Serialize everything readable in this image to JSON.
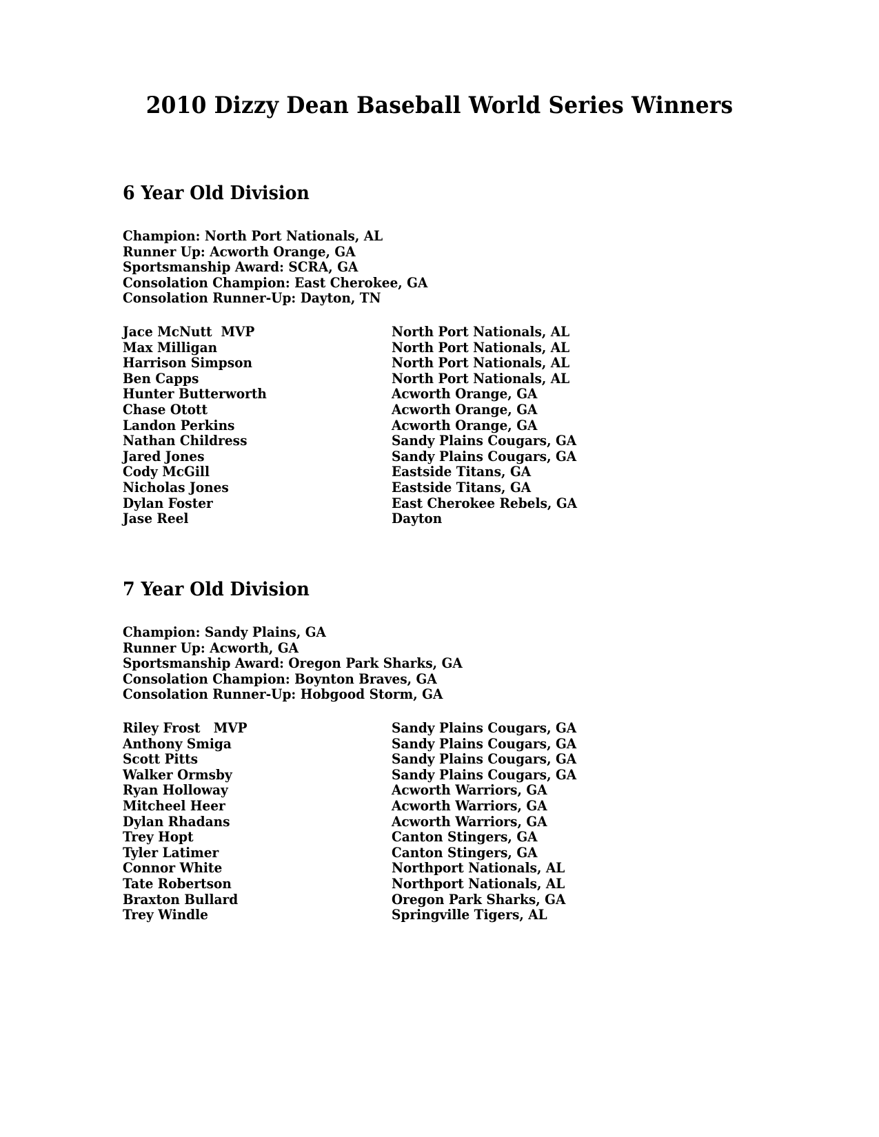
{
  "document": {
    "title": "2010 Dizzy Dean Baseball World Series Winners"
  },
  "sections": [
    {
      "heading": "6 Year Old Division",
      "awards": [
        "Champion: North Port Nationals, AL",
        "Runner Up: Acworth Orange, GA",
        "Sportsmanship Award: SCRA, GA",
        "Consolation Champion: East Cherokee, GA",
        "Consolation Runner-Up: Dayton, TN"
      ],
      "players": [
        {
          "name": "Jace McNutt  MVP",
          "team": "North Port Nationals, AL"
        },
        {
          "name": "Max Milligan",
          "team": "North Port Nationals, AL"
        },
        {
          "name": "Harrison Simpson",
          "team": "North Port Nationals, AL"
        },
        {
          "name": "Ben Capps",
          "team": "North Port Nationals, AL"
        },
        {
          "name": "Hunter Butterworth",
          "team": "Acworth Orange, GA"
        },
        {
          "name": "Chase Otott",
          "team": "Acworth Orange, GA"
        },
        {
          "name": "Landon Perkins",
          "team": "Acworth Orange, GA"
        },
        {
          "name": "Nathan Childress",
          "team": "Sandy Plains Cougars, GA"
        },
        {
          "name": "Jared Jones",
          "team": "Sandy Plains Cougars, GA"
        },
        {
          "name": "Cody McGill",
          "team": "Eastside Titans, GA"
        },
        {
          "name": "Nicholas Jones",
          "team": "Eastside Titans, GA"
        },
        {
          "name": "Dylan Foster",
          "team": "East Cherokee Rebels, GA"
        },
        {
          "name": "Jase Reel",
          "team": "Dayton"
        }
      ]
    },
    {
      "heading": "7 Year Old Division",
      "awards": [
        "Champion: Sandy Plains, GA",
        "Runner Up: Acworth, GA",
        "Sportsmanship Award: Oregon Park Sharks, GA",
        "Consolation Champion: Boynton Braves, GA",
        "Consolation Runner-Up: Hobgood Storm, GA"
      ],
      "players": [
        {
          "name": "Riley Frost   MVP",
          "team": "Sandy Plains Cougars, GA"
        },
        {
          "name": "Anthony Smiga",
          "team": "Sandy Plains Cougars, GA"
        },
        {
          "name": "Scott Pitts",
          "team": "Sandy Plains Cougars, GA"
        },
        {
          "name": "Walker Ormsby",
          "team": "Sandy Plains Cougars, GA"
        },
        {
          "name": "Ryan Holloway",
          "team": "Acworth Warriors, GA"
        },
        {
          "name": "Mitcheel Heer",
          "team": "Acworth Warriors, GA"
        },
        {
          "name": "Dylan Rhadans",
          "team": "Acworth Warriors, GA"
        },
        {
          "name": "Trey Hopt",
          "team": "Canton Stingers, GA"
        },
        {
          "name": "Tyler Latimer",
          "team": "Canton Stingers, GA"
        },
        {
          "name": "Connor White",
          "team": "Northport Nationals, AL"
        },
        {
          "name": "Tate Robertson",
          "team": "Northport Nationals, AL"
        },
        {
          "name": "Braxton Bullard",
          "team": "Oregon Park Sharks, GA"
        },
        {
          "name": "Trey Windle",
          "team": "Springville Tigers, AL"
        }
      ]
    }
  ]
}
